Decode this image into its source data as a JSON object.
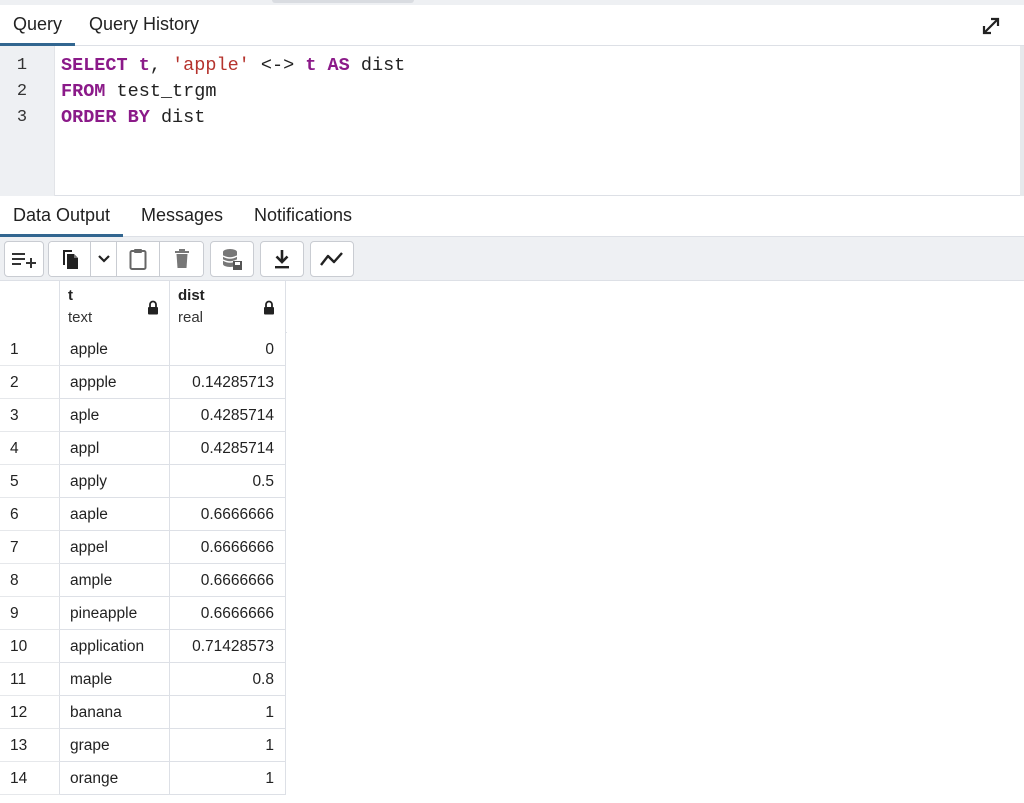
{
  "query_tabs": [
    {
      "label": "Query",
      "active": true
    },
    {
      "label": "Query History",
      "active": false
    }
  ],
  "editor": {
    "line_numbers": [
      "1",
      "2",
      "3"
    ],
    "line1": {
      "kw1": "SELECT",
      "t1": "t",
      "comma": ",",
      "str": "'apple'",
      "op": "<->",
      "t2": "t",
      "kw2": "AS",
      "alias": "dist"
    },
    "line2": {
      "kw": "FROM",
      "table": "test_trgm"
    },
    "line3": {
      "kw": "ORDER BY",
      "col": "dist"
    }
  },
  "result_tabs": [
    {
      "label": "Data Output",
      "active": true
    },
    {
      "label": "Messages",
      "active": false
    },
    {
      "label": "Notifications",
      "active": false
    }
  ],
  "toolbar": {
    "icons": [
      "add-row-icon",
      "copy-icon",
      "chevron-down-icon",
      "paste-icon",
      "delete-icon",
      "save-data-icon",
      "download-icon",
      "graph-icon"
    ]
  },
  "grid": {
    "columns": [
      {
        "name": "t",
        "type": "text"
      },
      {
        "name": "dist",
        "type": "real"
      }
    ],
    "rows": [
      {
        "n": "1",
        "t": "apple",
        "dist": "0"
      },
      {
        "n": "2",
        "t": "appple",
        "dist": "0.14285713"
      },
      {
        "n": "3",
        "t": "aple",
        "dist": "0.4285714"
      },
      {
        "n": "4",
        "t": "appl",
        "dist": "0.4285714"
      },
      {
        "n": "5",
        "t": "apply",
        "dist": "0.5"
      },
      {
        "n": "6",
        "t": "aaple",
        "dist": "0.6666666"
      },
      {
        "n": "7",
        "t": "appel",
        "dist": "0.6666666"
      },
      {
        "n": "8",
        "t": "ample",
        "dist": "0.6666666"
      },
      {
        "n": "9",
        "t": "pineapple",
        "dist": "0.6666666"
      },
      {
        "n": "10",
        "t": "application",
        "dist": "0.71428573"
      },
      {
        "n": "11",
        "t": "maple",
        "dist": "0.8"
      },
      {
        "n": "12",
        "t": "banana",
        "dist": "1"
      },
      {
        "n": "13",
        "t": "grape",
        "dist": "1"
      },
      {
        "n": "14",
        "t": "orange",
        "dist": "1"
      }
    ]
  },
  "colors": {
    "accent": "#326690",
    "keyword": "#8b1a89",
    "string": "#b5332d"
  }
}
